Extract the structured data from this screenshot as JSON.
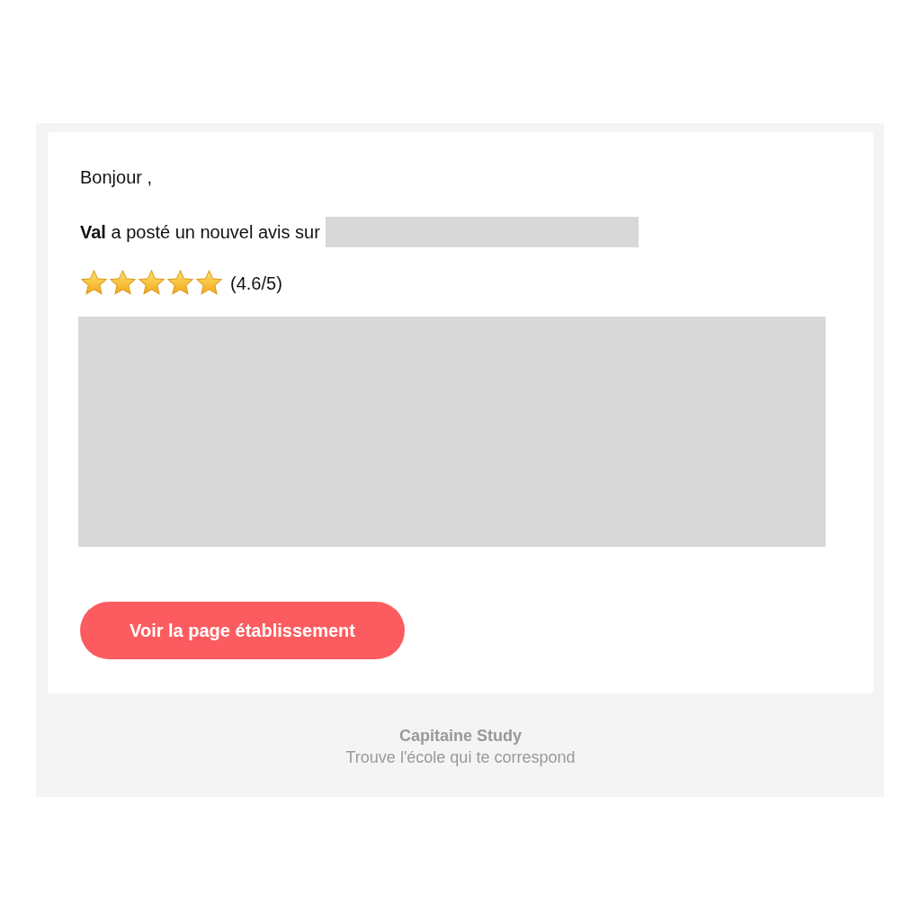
{
  "greeting": "Bonjour ,",
  "notice": "**Val** a posté un nouvel avis sur",
  "rating": {
    "stars": 5,
    "reading": "(4.6/5)"
  },
  "button": "Voir la page établissement",
  "footer": {
    "brand": "Capitaine Study",
    "tagline": "Trouve l'école qui te correspond"
  }
}
